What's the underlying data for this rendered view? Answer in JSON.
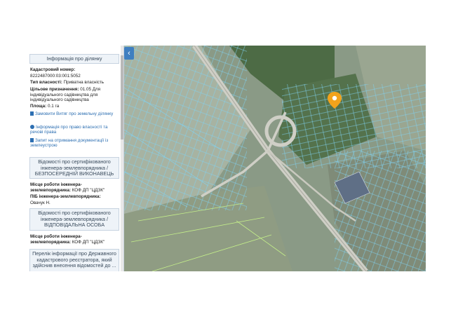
{
  "sidebar": {
    "section_info": "Інформація про ділянку",
    "cadastral_label": "Кадастровий номер:",
    "cadastral_value": "8222487000:03:001:5052",
    "ownership_label": "Тип власності:",
    "ownership_value": "Приватна власність",
    "purpose_label": "Цільове призначення:",
    "purpose_value": "01.05 Для індивідуального садівництва для індивідуального садівництва",
    "area_label": "Площа:",
    "area_value": "0.1 га",
    "links": [
      "Замовити Витяг про земельну ділянку",
      "Інформація про право власності та речові права",
      "Запит на отримання документації із землеустрою"
    ],
    "section_engineer": "Відомості про сертифікованого інженера-землевпорядника / БЕЗПОСЕРЕДНІЙ ВИКОНАВЕЦЬ",
    "work1_label": "Місце роботи інженера-землевпорядника:",
    "work1_value": "КОФ ДП \"ЦДЗК\"",
    "name_label": "ПІБ інженера-землевпорядника:",
    "name_value": "Овачук Н.",
    "section_engineer2": "Відомості про сертифікованого інженера-землевпорядника / ВІДПОВІДАЛЬНА ОСОБА",
    "work2_label": "Місце роботи інженера-землевпорядника:",
    "work2_value": "КОФ ДП \"ЦДЗК\"",
    "section_list": "Перелік інформації про Державного кадастрового реєстратора, який здійснив внесення відомостей до ..."
  },
  "map": {
    "collapse_glyph": "‹",
    "marker_icon": "map-pin-icon"
  },
  "colors": {
    "accent": "#3f7fc0",
    "parcel_stroke": "#7fd2f2",
    "marker": "#f2a31b"
  }
}
